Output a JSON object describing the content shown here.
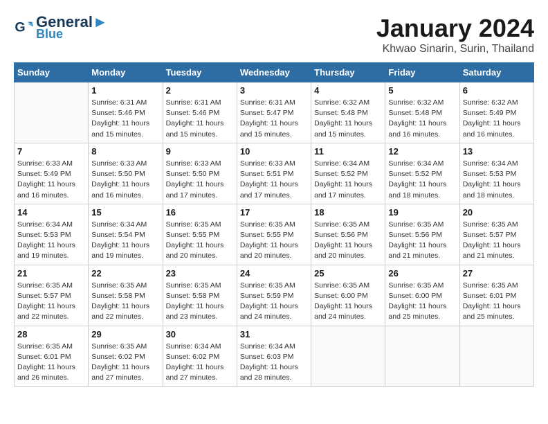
{
  "logo": {
    "line1": "General",
    "line2": "Blue"
  },
  "title": "January 2024",
  "subtitle": "Khwao Sinarin, Surin, Thailand",
  "headers": [
    "Sunday",
    "Monday",
    "Tuesday",
    "Wednesday",
    "Thursday",
    "Friday",
    "Saturday"
  ],
  "weeks": [
    [
      {
        "num": "",
        "info": ""
      },
      {
        "num": "1",
        "info": "Sunrise: 6:31 AM\nSunset: 5:46 PM\nDaylight: 11 hours\nand 15 minutes."
      },
      {
        "num": "2",
        "info": "Sunrise: 6:31 AM\nSunset: 5:46 PM\nDaylight: 11 hours\nand 15 minutes."
      },
      {
        "num": "3",
        "info": "Sunrise: 6:31 AM\nSunset: 5:47 PM\nDaylight: 11 hours\nand 15 minutes."
      },
      {
        "num": "4",
        "info": "Sunrise: 6:32 AM\nSunset: 5:48 PM\nDaylight: 11 hours\nand 15 minutes."
      },
      {
        "num": "5",
        "info": "Sunrise: 6:32 AM\nSunset: 5:48 PM\nDaylight: 11 hours\nand 16 minutes."
      },
      {
        "num": "6",
        "info": "Sunrise: 6:32 AM\nSunset: 5:49 PM\nDaylight: 11 hours\nand 16 minutes."
      }
    ],
    [
      {
        "num": "7",
        "info": "Sunrise: 6:33 AM\nSunset: 5:49 PM\nDaylight: 11 hours\nand 16 minutes."
      },
      {
        "num": "8",
        "info": "Sunrise: 6:33 AM\nSunset: 5:50 PM\nDaylight: 11 hours\nand 16 minutes."
      },
      {
        "num": "9",
        "info": "Sunrise: 6:33 AM\nSunset: 5:50 PM\nDaylight: 11 hours\nand 17 minutes."
      },
      {
        "num": "10",
        "info": "Sunrise: 6:33 AM\nSunset: 5:51 PM\nDaylight: 11 hours\nand 17 minutes."
      },
      {
        "num": "11",
        "info": "Sunrise: 6:34 AM\nSunset: 5:52 PM\nDaylight: 11 hours\nand 17 minutes."
      },
      {
        "num": "12",
        "info": "Sunrise: 6:34 AM\nSunset: 5:52 PM\nDaylight: 11 hours\nand 18 minutes."
      },
      {
        "num": "13",
        "info": "Sunrise: 6:34 AM\nSunset: 5:53 PM\nDaylight: 11 hours\nand 18 minutes."
      }
    ],
    [
      {
        "num": "14",
        "info": "Sunrise: 6:34 AM\nSunset: 5:53 PM\nDaylight: 11 hours\nand 19 minutes."
      },
      {
        "num": "15",
        "info": "Sunrise: 6:34 AM\nSunset: 5:54 PM\nDaylight: 11 hours\nand 19 minutes."
      },
      {
        "num": "16",
        "info": "Sunrise: 6:35 AM\nSunset: 5:55 PM\nDaylight: 11 hours\nand 20 minutes."
      },
      {
        "num": "17",
        "info": "Sunrise: 6:35 AM\nSunset: 5:55 PM\nDaylight: 11 hours\nand 20 minutes."
      },
      {
        "num": "18",
        "info": "Sunrise: 6:35 AM\nSunset: 5:56 PM\nDaylight: 11 hours\nand 20 minutes."
      },
      {
        "num": "19",
        "info": "Sunrise: 6:35 AM\nSunset: 5:56 PM\nDaylight: 11 hours\nand 21 minutes."
      },
      {
        "num": "20",
        "info": "Sunrise: 6:35 AM\nSunset: 5:57 PM\nDaylight: 11 hours\nand 21 minutes."
      }
    ],
    [
      {
        "num": "21",
        "info": "Sunrise: 6:35 AM\nSunset: 5:57 PM\nDaylight: 11 hours\nand 22 minutes."
      },
      {
        "num": "22",
        "info": "Sunrise: 6:35 AM\nSunset: 5:58 PM\nDaylight: 11 hours\nand 22 minutes."
      },
      {
        "num": "23",
        "info": "Sunrise: 6:35 AM\nSunset: 5:58 PM\nDaylight: 11 hours\nand 23 minutes."
      },
      {
        "num": "24",
        "info": "Sunrise: 6:35 AM\nSunset: 5:59 PM\nDaylight: 11 hours\nand 24 minutes."
      },
      {
        "num": "25",
        "info": "Sunrise: 6:35 AM\nSunset: 6:00 PM\nDaylight: 11 hours\nand 24 minutes."
      },
      {
        "num": "26",
        "info": "Sunrise: 6:35 AM\nSunset: 6:00 PM\nDaylight: 11 hours\nand 25 minutes."
      },
      {
        "num": "27",
        "info": "Sunrise: 6:35 AM\nSunset: 6:01 PM\nDaylight: 11 hours\nand 25 minutes."
      }
    ],
    [
      {
        "num": "28",
        "info": "Sunrise: 6:35 AM\nSunset: 6:01 PM\nDaylight: 11 hours\nand 26 minutes."
      },
      {
        "num": "29",
        "info": "Sunrise: 6:35 AM\nSunset: 6:02 PM\nDaylight: 11 hours\nand 27 minutes."
      },
      {
        "num": "30",
        "info": "Sunrise: 6:34 AM\nSunset: 6:02 PM\nDaylight: 11 hours\nand 27 minutes."
      },
      {
        "num": "31",
        "info": "Sunrise: 6:34 AM\nSunset: 6:03 PM\nDaylight: 11 hours\nand 28 minutes."
      },
      {
        "num": "",
        "info": ""
      },
      {
        "num": "",
        "info": ""
      },
      {
        "num": "",
        "info": ""
      }
    ]
  ]
}
